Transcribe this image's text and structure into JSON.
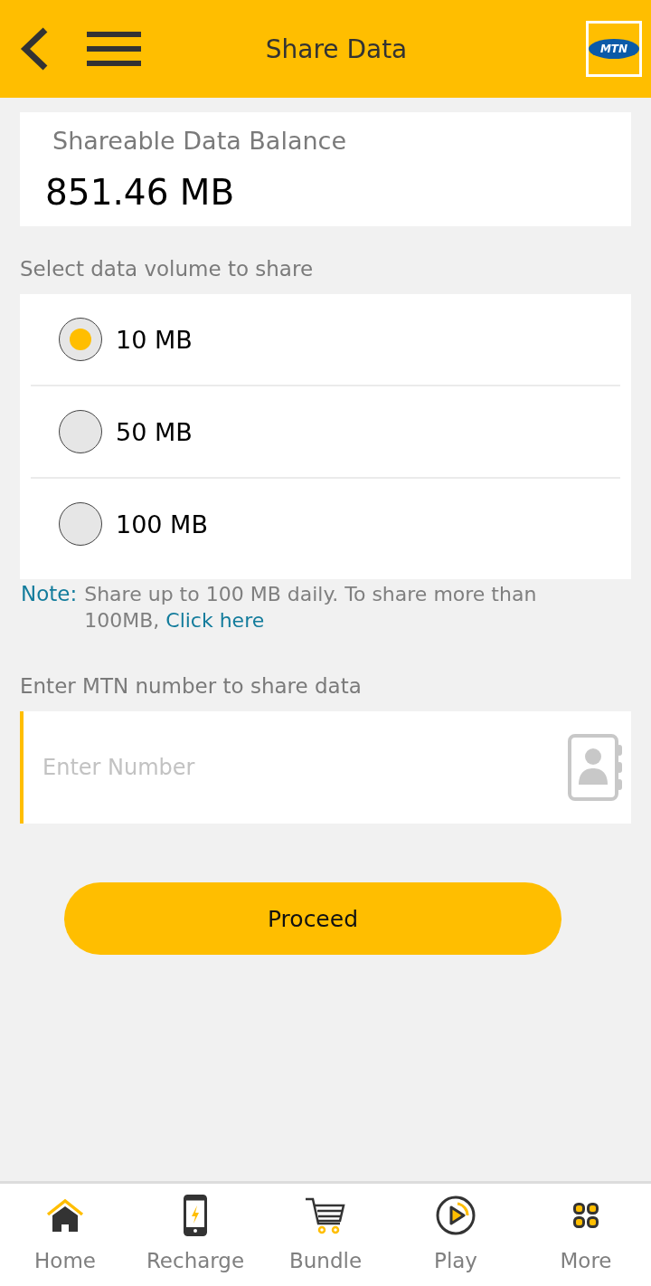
{
  "header": {
    "title": "Share Data",
    "logo_text": "MTN"
  },
  "balance": {
    "label": "Shareable Data Balance",
    "value": "851.46 MB"
  },
  "volume": {
    "label": "Select data volume to share",
    "options": [
      {
        "label": "10 MB",
        "selected": true
      },
      {
        "label": "50 MB",
        "selected": false
      },
      {
        "label": "100 MB",
        "selected": false
      }
    ]
  },
  "note": {
    "label": "Note:",
    "text": "Share up to 100 MB daily. To share more than 100MB,",
    "link": "Click here"
  },
  "number": {
    "label": "Enter MTN number to share data",
    "placeholder": "Enter Number"
  },
  "proceed": {
    "label": "Proceed"
  },
  "nav": [
    {
      "label": "Home",
      "kind": "home"
    },
    {
      "label": "Recharge",
      "kind": "recharge"
    },
    {
      "label": "Bundle",
      "kind": "bundle"
    },
    {
      "label": "Play",
      "kind": "play"
    },
    {
      "label": "More",
      "kind": "more"
    }
  ]
}
